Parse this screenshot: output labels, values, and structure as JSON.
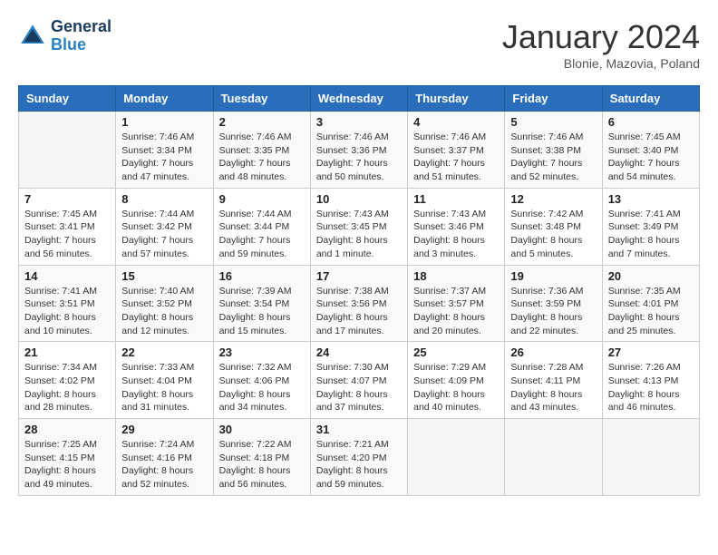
{
  "logo": {
    "line1": "General",
    "line2": "Blue"
  },
  "title": "January 2024",
  "subtitle": "Blonie, Mazovia, Poland",
  "headers": [
    "Sunday",
    "Monday",
    "Tuesday",
    "Wednesday",
    "Thursday",
    "Friday",
    "Saturday"
  ],
  "weeks": [
    [
      {
        "day": "",
        "sunrise": "",
        "sunset": "",
        "daylight": ""
      },
      {
        "day": "1",
        "sunrise": "Sunrise: 7:46 AM",
        "sunset": "Sunset: 3:34 PM",
        "daylight": "Daylight: 7 hours and 47 minutes."
      },
      {
        "day": "2",
        "sunrise": "Sunrise: 7:46 AM",
        "sunset": "Sunset: 3:35 PM",
        "daylight": "Daylight: 7 hours and 48 minutes."
      },
      {
        "day": "3",
        "sunrise": "Sunrise: 7:46 AM",
        "sunset": "Sunset: 3:36 PM",
        "daylight": "Daylight: 7 hours and 50 minutes."
      },
      {
        "day": "4",
        "sunrise": "Sunrise: 7:46 AM",
        "sunset": "Sunset: 3:37 PM",
        "daylight": "Daylight: 7 hours and 51 minutes."
      },
      {
        "day": "5",
        "sunrise": "Sunrise: 7:46 AM",
        "sunset": "Sunset: 3:38 PM",
        "daylight": "Daylight: 7 hours and 52 minutes."
      },
      {
        "day": "6",
        "sunrise": "Sunrise: 7:45 AM",
        "sunset": "Sunset: 3:40 PM",
        "daylight": "Daylight: 7 hours and 54 minutes."
      }
    ],
    [
      {
        "day": "7",
        "sunrise": "Sunrise: 7:45 AM",
        "sunset": "Sunset: 3:41 PM",
        "daylight": "Daylight: 7 hours and 56 minutes."
      },
      {
        "day": "8",
        "sunrise": "Sunrise: 7:44 AM",
        "sunset": "Sunset: 3:42 PM",
        "daylight": "Daylight: 7 hours and 57 minutes."
      },
      {
        "day": "9",
        "sunrise": "Sunrise: 7:44 AM",
        "sunset": "Sunset: 3:44 PM",
        "daylight": "Daylight: 7 hours and 59 minutes."
      },
      {
        "day": "10",
        "sunrise": "Sunrise: 7:43 AM",
        "sunset": "Sunset: 3:45 PM",
        "daylight": "Daylight: 8 hours and 1 minute."
      },
      {
        "day": "11",
        "sunrise": "Sunrise: 7:43 AM",
        "sunset": "Sunset: 3:46 PM",
        "daylight": "Daylight: 8 hours and 3 minutes."
      },
      {
        "day": "12",
        "sunrise": "Sunrise: 7:42 AM",
        "sunset": "Sunset: 3:48 PM",
        "daylight": "Daylight: 8 hours and 5 minutes."
      },
      {
        "day": "13",
        "sunrise": "Sunrise: 7:41 AM",
        "sunset": "Sunset: 3:49 PM",
        "daylight": "Daylight: 8 hours and 7 minutes."
      }
    ],
    [
      {
        "day": "14",
        "sunrise": "Sunrise: 7:41 AM",
        "sunset": "Sunset: 3:51 PM",
        "daylight": "Daylight: 8 hours and 10 minutes."
      },
      {
        "day": "15",
        "sunrise": "Sunrise: 7:40 AM",
        "sunset": "Sunset: 3:52 PM",
        "daylight": "Daylight: 8 hours and 12 minutes."
      },
      {
        "day": "16",
        "sunrise": "Sunrise: 7:39 AM",
        "sunset": "Sunset: 3:54 PM",
        "daylight": "Daylight: 8 hours and 15 minutes."
      },
      {
        "day": "17",
        "sunrise": "Sunrise: 7:38 AM",
        "sunset": "Sunset: 3:56 PM",
        "daylight": "Daylight: 8 hours and 17 minutes."
      },
      {
        "day": "18",
        "sunrise": "Sunrise: 7:37 AM",
        "sunset": "Sunset: 3:57 PM",
        "daylight": "Daylight: 8 hours and 20 minutes."
      },
      {
        "day": "19",
        "sunrise": "Sunrise: 7:36 AM",
        "sunset": "Sunset: 3:59 PM",
        "daylight": "Daylight: 8 hours and 22 minutes."
      },
      {
        "day": "20",
        "sunrise": "Sunrise: 7:35 AM",
        "sunset": "Sunset: 4:01 PM",
        "daylight": "Daylight: 8 hours and 25 minutes."
      }
    ],
    [
      {
        "day": "21",
        "sunrise": "Sunrise: 7:34 AM",
        "sunset": "Sunset: 4:02 PM",
        "daylight": "Daylight: 8 hours and 28 minutes."
      },
      {
        "day": "22",
        "sunrise": "Sunrise: 7:33 AM",
        "sunset": "Sunset: 4:04 PM",
        "daylight": "Daylight: 8 hours and 31 minutes."
      },
      {
        "day": "23",
        "sunrise": "Sunrise: 7:32 AM",
        "sunset": "Sunset: 4:06 PM",
        "daylight": "Daylight: 8 hours and 34 minutes."
      },
      {
        "day": "24",
        "sunrise": "Sunrise: 7:30 AM",
        "sunset": "Sunset: 4:07 PM",
        "daylight": "Daylight: 8 hours and 37 minutes."
      },
      {
        "day": "25",
        "sunrise": "Sunrise: 7:29 AM",
        "sunset": "Sunset: 4:09 PM",
        "daylight": "Daylight: 8 hours and 40 minutes."
      },
      {
        "day": "26",
        "sunrise": "Sunrise: 7:28 AM",
        "sunset": "Sunset: 4:11 PM",
        "daylight": "Daylight: 8 hours and 43 minutes."
      },
      {
        "day": "27",
        "sunrise": "Sunrise: 7:26 AM",
        "sunset": "Sunset: 4:13 PM",
        "daylight": "Daylight: 8 hours and 46 minutes."
      }
    ],
    [
      {
        "day": "28",
        "sunrise": "Sunrise: 7:25 AM",
        "sunset": "Sunset: 4:15 PM",
        "daylight": "Daylight: 8 hours and 49 minutes."
      },
      {
        "day": "29",
        "sunrise": "Sunrise: 7:24 AM",
        "sunset": "Sunset: 4:16 PM",
        "daylight": "Daylight: 8 hours and 52 minutes."
      },
      {
        "day": "30",
        "sunrise": "Sunrise: 7:22 AM",
        "sunset": "Sunset: 4:18 PM",
        "daylight": "Daylight: 8 hours and 56 minutes."
      },
      {
        "day": "31",
        "sunrise": "Sunrise: 7:21 AM",
        "sunset": "Sunset: 4:20 PM",
        "daylight": "Daylight: 8 hours and 59 minutes."
      },
      {
        "day": "",
        "sunrise": "",
        "sunset": "",
        "daylight": ""
      },
      {
        "day": "",
        "sunrise": "",
        "sunset": "",
        "daylight": ""
      },
      {
        "day": "",
        "sunrise": "",
        "sunset": "",
        "daylight": ""
      }
    ]
  ]
}
